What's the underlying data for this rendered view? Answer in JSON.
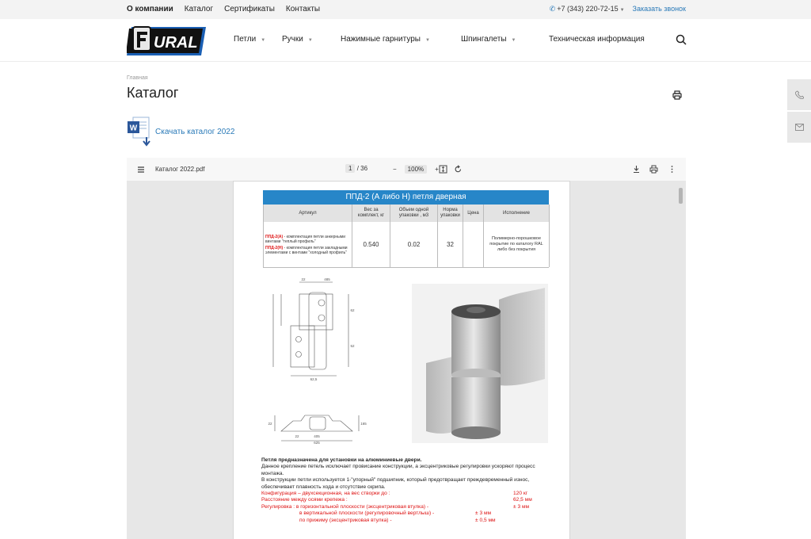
{
  "top_nav": [
    "О компании",
    "Каталог",
    "Сертификаты",
    "Контакты"
  ],
  "phone": "+7 (343) 220-72-15",
  "callback_label": "Заказать звонок",
  "logo_text": "URAL",
  "main_nav": [
    "Петли",
    "Ручки",
    "Нажимные гарнитуры",
    "Шпингалеты",
    "Техническая информация"
  ],
  "breadcrumb": "Главная",
  "page_title": "Каталог",
  "download_label": "Скачать каталог 2022",
  "viewer": {
    "filename": "Каталог 2022.pdf",
    "page_current": "1",
    "page_total": "/ 36",
    "zoom": "100%"
  },
  "pdf": {
    "title": "ППД-2 (А либо Н) петля дверная",
    "headers": [
      "Артикул",
      "Вес за комплект, кг",
      "Объем одной упаковки , м3",
      "Норма упаковки",
      "Цена",
      "Исполнение"
    ],
    "art_a_code": "ППД-2(А)",
    "art_a_text": " - комплектация петли анкерными винтами \"теплый профиль\"",
    "art_h_code": "ППД-2(Н)",
    "art_h_text": " - комплектация петли закладными элементами с винтами \"холодный профиль\"",
    "weight": "0.540",
    "volume": "0.02",
    "norm": "32",
    "price": "",
    "execution": "Полимерно-порошковое покрытие по каталогу RAL либо без покрытия",
    "text_bold": "Петля предназначена для установки на алюминиевые двери.",
    "text_p1": "Данное крепление петель исключает провисание конструкции, а эксцентриковые регулировки ускоряют процесс монтажа.",
    "text_p2": "В конструкции петли используется 1-\"упорный\" подшипник, который предотвращает преждевременный износ, обеспечивает плавность хода и отсутствие скрипа.",
    "spec1_label": "Конфигурация – двухсекционная, на вес створки до :",
    "spec1_value": "120 кг",
    "spec2_label": "Расстояние между осями крепежа :",
    "spec2_value": "62,5 мм",
    "spec3_label": "Регулировка : в горизонтальной плоскости (эксцентриковая втулка) -",
    "spec3_value": "± 3 мм",
    "spec4_label": "в вертикальной плоскости (регулировочный вертлыш) -",
    "spec4_value": "± 3 мм",
    "spec5_label": "по прижиму (эксцентриковая втулка) -",
    "spec5_value": "± 0,5 мм",
    "drawing_dims": [
      "22",
      "485",
      "62",
      "52",
      "62,5",
      "22",
      "405",
      "625",
      "22",
      "165"
    ]
  }
}
